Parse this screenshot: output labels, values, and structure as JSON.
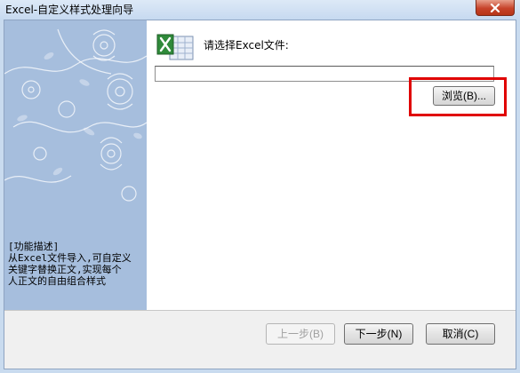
{
  "window": {
    "title": "Excel-自定义样式处理向导"
  },
  "sidebar": {
    "description_lines": [
      "[功能描述]",
      "从Excel文件导入,可自定义",
      "关键字替换正文,实现每个",
      "人正文的自由组合样式"
    ]
  },
  "main": {
    "prompt": "请选择Excel文件:",
    "file_path": {
      "value": "",
      "placeholder": ""
    },
    "browse_label": "浏览(B)..."
  },
  "footer": {
    "prev_label": "上一步(B)",
    "next_label": "下一步(N)",
    "cancel_label": "取消(C)"
  },
  "colors": {
    "side_panel": "#a6bedd",
    "highlight": "#e00000",
    "close_button": "#c7432a"
  },
  "icons": {
    "close": "close-icon",
    "excel": "excel-icon",
    "decoration": "flower-decoration"
  }
}
